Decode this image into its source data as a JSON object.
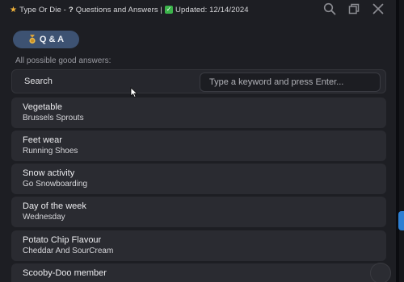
{
  "titlebar": {
    "star_icon": "star-icon",
    "title_part1": "Type Or Die -",
    "question_mark": "?",
    "title_part2": "Questions and Answers |",
    "check_mark": "✓",
    "title_part3": "Updated: 12/14/2024"
  },
  "window_controls": {
    "search_icon": "search-icon",
    "restore_icon": "restore-icon",
    "close_icon": "close-icon"
  },
  "chip": {
    "label": "Q & A",
    "icon": "medal-icon"
  },
  "subheading": "All possible good answers:",
  "search": {
    "label": "Search",
    "value": "",
    "placeholder": "Type a keyword and press Enter..."
  },
  "answers": [
    {
      "category": "Vegetable",
      "answer": "Brussels Sprouts"
    },
    {
      "category": "Feet wear",
      "answer": "Running Shoes"
    },
    {
      "category": "Snow activity",
      "answer": "Go Snowboarding"
    },
    {
      "category": "Day of the week",
      "answer": "Wednesday"
    },
    {
      "category": "Potato Chip Flavour",
      "answer": "Cheddar And SourCream"
    },
    {
      "category": "Scooby-Doo member",
      "answer": ""
    }
  ],
  "colors": {
    "accent_chip": "#3d5272",
    "background": "#1d1e23",
    "card": "#2a2b31",
    "star": "#f0b23a",
    "check": "#3cb44b"
  }
}
